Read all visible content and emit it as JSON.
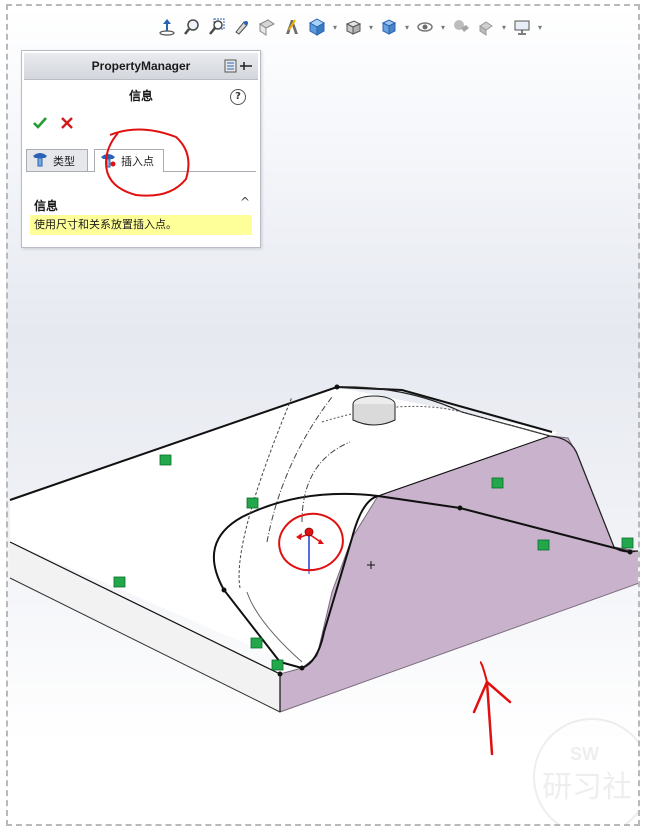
{
  "toolbar": {
    "icons": [
      "normal-to-icon",
      "zoom-to-fit-icon",
      "zoom-area-icon",
      "previous-view-icon",
      "section-view-icon",
      "dynamic-annotation-icon",
      "view-orientation-icon",
      "display-style-icon",
      "hide-show-items-icon",
      "edit-appearance-icon",
      "apply-scene-icon",
      "view-settings-icon"
    ]
  },
  "property_manager": {
    "title": "PropertyManager",
    "feature_name": "信息",
    "help_glyph": "?",
    "tabs": [
      {
        "label": "类型",
        "icon": "hole-type-icon"
      },
      {
        "label": "插入点",
        "icon": "hole-position-icon"
      }
    ],
    "section_title": "信息",
    "section_chevron": "^",
    "message": "使用尺寸和关系放置插入点。"
  },
  "colors": {
    "face_highlight": "#c9b3cc",
    "relation_marker": "#22a84a",
    "annotation_red": "#e01010",
    "message_bg": "#ffff99"
  }
}
